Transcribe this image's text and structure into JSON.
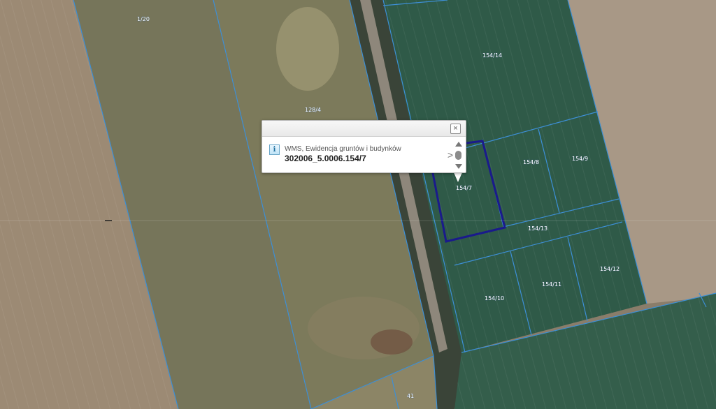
{
  "map": {
    "parcels": [
      {
        "label": "1/20",
        "color": "#7b7a5c"
      },
      {
        "label": "128/4",
        "color": "#7f7c5d"
      },
      {
        "label": "154/14",
        "color": "#2f5a48"
      },
      {
        "label": "154/8",
        "color": "#2e5846"
      },
      {
        "label": "154/9",
        "color": "#2e5846"
      },
      {
        "label": "154/7",
        "color": "#2e5846"
      },
      {
        "label": "154/13",
        "color": "#2f5a48"
      },
      {
        "label": "154/10",
        "color": "#2e5846"
      },
      {
        "label": "154/11",
        "color": "#2e5846"
      },
      {
        "label": "154/12",
        "color": "#2e5846"
      },
      {
        "label": "41",
        "color": "#8c8566"
      }
    ],
    "boundary_color": "#3d8fd6",
    "selection_color": "#1a1a8c"
  },
  "popup": {
    "close_icon": "close-icon",
    "info_icon_glyph": "i",
    "layer_name": "WMS, Ewidencja gruntów i budynków",
    "feature_id": "302006_5.0006.154/7",
    "next_glyph": ">"
  }
}
